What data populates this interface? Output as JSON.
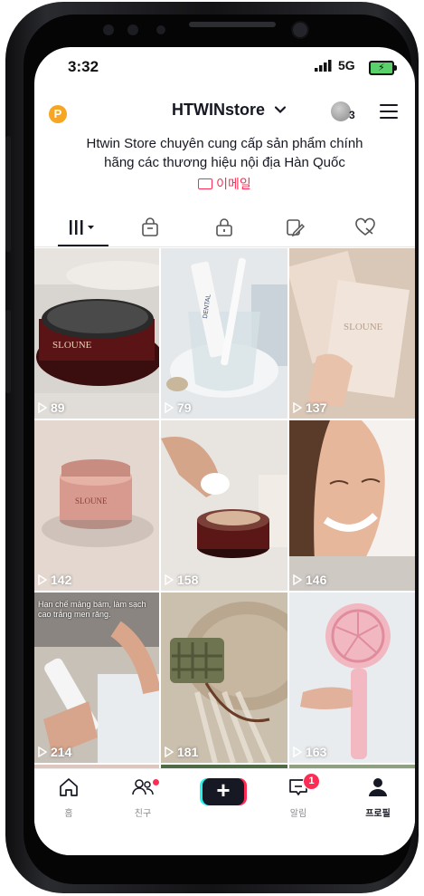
{
  "status_bar": {
    "time": "3:32",
    "network": "5G"
  },
  "header": {
    "coin_label": "P",
    "username": "HTWINstore",
    "account_count": "3",
    "bio_line1": "Htwin Store chuyên cung cấp sản phẩm chính",
    "bio_line2": "hãng các thương hiệu nội địa Hàn Quốc",
    "email_label": "이메일"
  },
  "tabs": [
    {
      "icon": "grid-icon",
      "active": true
    },
    {
      "icon": "shop-bag-icon"
    },
    {
      "icon": "lock-icon"
    },
    {
      "icon": "repost-icon"
    },
    {
      "icon": "liked-icon"
    }
  ],
  "videos": [
    {
      "views": "89",
      "desc": "SLOUNE cream jar"
    },
    {
      "views": "79",
      "desc": "toothpaste and toothbrush in glass"
    },
    {
      "views": "137",
      "desc": "SLOUNE mask sheets"
    },
    {
      "views": "142",
      "desc": "SLOUNE pink cream jar"
    },
    {
      "views": "158",
      "desc": "hand with cotton pad and cream jar"
    },
    {
      "views": "146",
      "desc": "smiling woman"
    },
    {
      "views": "214",
      "desc": "toothpaste tube",
      "caption": "Hạn chế mảng bám, làm sạch cao trắng men răng."
    },
    {
      "views": "181",
      "desc": "waffle soap on tray"
    },
    {
      "views": "163",
      "desc": "pink handheld fan"
    }
  ],
  "bottom_nav": [
    {
      "label": "홈",
      "icon": "home-icon"
    },
    {
      "label": "친구",
      "icon": "friends-icon"
    },
    {
      "label": "",
      "icon": "create-plus-icon"
    },
    {
      "label": "알림",
      "icon": "inbox-icon",
      "badge": "1"
    },
    {
      "label": "프로필",
      "icon": "profile-icon",
      "active": true
    }
  ],
  "colors": {
    "accent": "#fe2c55",
    "text": "#161823",
    "coin": "#f6a623"
  }
}
